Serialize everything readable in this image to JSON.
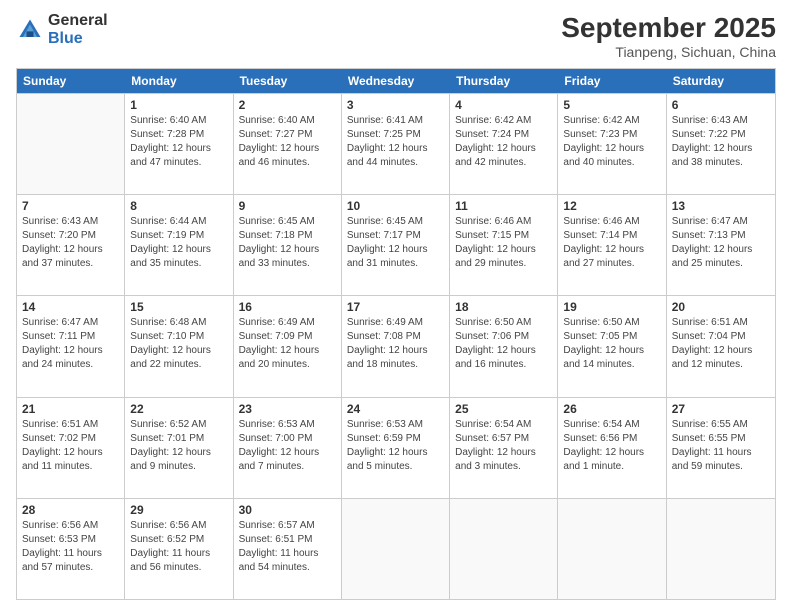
{
  "logo": {
    "general": "General",
    "blue": "Blue"
  },
  "header": {
    "month": "September 2025",
    "location": "Tianpeng, Sichuan, China"
  },
  "weekdays": [
    "Sunday",
    "Monday",
    "Tuesday",
    "Wednesday",
    "Thursday",
    "Friday",
    "Saturday"
  ],
  "rows": [
    [
      {
        "day": "",
        "lines": [],
        "empty": true
      },
      {
        "day": "1",
        "lines": [
          "Sunrise: 6:40 AM",
          "Sunset: 7:28 PM",
          "Daylight: 12 hours",
          "and 47 minutes."
        ]
      },
      {
        "day": "2",
        "lines": [
          "Sunrise: 6:40 AM",
          "Sunset: 7:27 PM",
          "Daylight: 12 hours",
          "and 46 minutes."
        ]
      },
      {
        "day": "3",
        "lines": [
          "Sunrise: 6:41 AM",
          "Sunset: 7:25 PM",
          "Daylight: 12 hours",
          "and 44 minutes."
        ]
      },
      {
        "day": "4",
        "lines": [
          "Sunrise: 6:42 AM",
          "Sunset: 7:24 PM",
          "Daylight: 12 hours",
          "and 42 minutes."
        ]
      },
      {
        "day": "5",
        "lines": [
          "Sunrise: 6:42 AM",
          "Sunset: 7:23 PM",
          "Daylight: 12 hours",
          "and 40 minutes."
        ]
      },
      {
        "day": "6",
        "lines": [
          "Sunrise: 6:43 AM",
          "Sunset: 7:22 PM",
          "Daylight: 12 hours",
          "and 38 minutes."
        ]
      }
    ],
    [
      {
        "day": "7",
        "lines": [
          "Sunrise: 6:43 AM",
          "Sunset: 7:20 PM",
          "Daylight: 12 hours",
          "and 37 minutes."
        ]
      },
      {
        "day": "8",
        "lines": [
          "Sunrise: 6:44 AM",
          "Sunset: 7:19 PM",
          "Daylight: 12 hours",
          "and 35 minutes."
        ]
      },
      {
        "day": "9",
        "lines": [
          "Sunrise: 6:45 AM",
          "Sunset: 7:18 PM",
          "Daylight: 12 hours",
          "and 33 minutes."
        ]
      },
      {
        "day": "10",
        "lines": [
          "Sunrise: 6:45 AM",
          "Sunset: 7:17 PM",
          "Daylight: 12 hours",
          "and 31 minutes."
        ]
      },
      {
        "day": "11",
        "lines": [
          "Sunrise: 6:46 AM",
          "Sunset: 7:15 PM",
          "Daylight: 12 hours",
          "and 29 minutes."
        ]
      },
      {
        "day": "12",
        "lines": [
          "Sunrise: 6:46 AM",
          "Sunset: 7:14 PM",
          "Daylight: 12 hours",
          "and 27 minutes."
        ]
      },
      {
        "day": "13",
        "lines": [
          "Sunrise: 6:47 AM",
          "Sunset: 7:13 PM",
          "Daylight: 12 hours",
          "and 25 minutes."
        ]
      }
    ],
    [
      {
        "day": "14",
        "lines": [
          "Sunrise: 6:47 AM",
          "Sunset: 7:11 PM",
          "Daylight: 12 hours",
          "and 24 minutes."
        ]
      },
      {
        "day": "15",
        "lines": [
          "Sunrise: 6:48 AM",
          "Sunset: 7:10 PM",
          "Daylight: 12 hours",
          "and 22 minutes."
        ]
      },
      {
        "day": "16",
        "lines": [
          "Sunrise: 6:49 AM",
          "Sunset: 7:09 PM",
          "Daylight: 12 hours",
          "and 20 minutes."
        ]
      },
      {
        "day": "17",
        "lines": [
          "Sunrise: 6:49 AM",
          "Sunset: 7:08 PM",
          "Daylight: 12 hours",
          "and 18 minutes."
        ]
      },
      {
        "day": "18",
        "lines": [
          "Sunrise: 6:50 AM",
          "Sunset: 7:06 PM",
          "Daylight: 12 hours",
          "and 16 minutes."
        ]
      },
      {
        "day": "19",
        "lines": [
          "Sunrise: 6:50 AM",
          "Sunset: 7:05 PM",
          "Daylight: 12 hours",
          "and 14 minutes."
        ]
      },
      {
        "day": "20",
        "lines": [
          "Sunrise: 6:51 AM",
          "Sunset: 7:04 PM",
          "Daylight: 12 hours",
          "and 12 minutes."
        ]
      }
    ],
    [
      {
        "day": "21",
        "lines": [
          "Sunrise: 6:51 AM",
          "Sunset: 7:02 PM",
          "Daylight: 12 hours",
          "and 11 minutes."
        ]
      },
      {
        "day": "22",
        "lines": [
          "Sunrise: 6:52 AM",
          "Sunset: 7:01 PM",
          "Daylight: 12 hours",
          "and 9 minutes."
        ]
      },
      {
        "day": "23",
        "lines": [
          "Sunrise: 6:53 AM",
          "Sunset: 7:00 PM",
          "Daylight: 12 hours",
          "and 7 minutes."
        ]
      },
      {
        "day": "24",
        "lines": [
          "Sunrise: 6:53 AM",
          "Sunset: 6:59 PM",
          "Daylight: 12 hours",
          "and 5 minutes."
        ]
      },
      {
        "day": "25",
        "lines": [
          "Sunrise: 6:54 AM",
          "Sunset: 6:57 PM",
          "Daylight: 12 hours",
          "and 3 minutes."
        ]
      },
      {
        "day": "26",
        "lines": [
          "Sunrise: 6:54 AM",
          "Sunset: 6:56 PM",
          "Daylight: 12 hours",
          "and 1 minute."
        ]
      },
      {
        "day": "27",
        "lines": [
          "Sunrise: 6:55 AM",
          "Sunset: 6:55 PM",
          "Daylight: 11 hours",
          "and 59 minutes."
        ]
      }
    ],
    [
      {
        "day": "28",
        "lines": [
          "Sunrise: 6:56 AM",
          "Sunset: 6:53 PM",
          "Daylight: 11 hours",
          "and 57 minutes."
        ]
      },
      {
        "day": "29",
        "lines": [
          "Sunrise: 6:56 AM",
          "Sunset: 6:52 PM",
          "Daylight: 11 hours",
          "and 56 minutes."
        ]
      },
      {
        "day": "30",
        "lines": [
          "Sunrise: 6:57 AM",
          "Sunset: 6:51 PM",
          "Daylight: 11 hours",
          "and 54 minutes."
        ]
      },
      {
        "day": "",
        "lines": [],
        "empty": true
      },
      {
        "day": "",
        "lines": [],
        "empty": true
      },
      {
        "day": "",
        "lines": [],
        "empty": true
      },
      {
        "day": "",
        "lines": [],
        "empty": true
      }
    ]
  ]
}
